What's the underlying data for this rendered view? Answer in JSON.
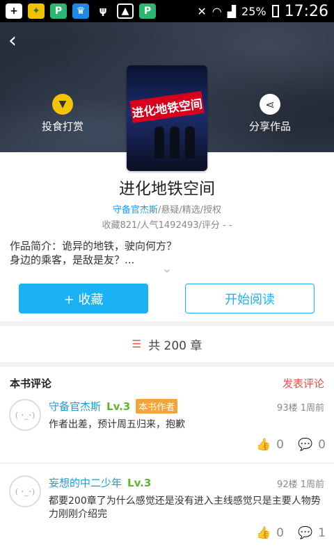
{
  "status_bar": {
    "battery": "25%",
    "time": "17:26"
  },
  "hero": {
    "tip_label": "投食打赏",
    "share_label": "分享作品",
    "cover_text": "进化地铁空间"
  },
  "book": {
    "title": "进化地铁空间",
    "author": "守备官杰斯",
    "tags": "/悬疑/精选/授权",
    "stats": "收藏821/人气1492493/评分 - -",
    "intro": "作品简介：诡异的地铁，驶向何方？\n身边的乘客，是敌是友？..."
  },
  "actions": {
    "favorite_label": "+ 收藏",
    "read_label": "开始阅读"
  },
  "chapters": {
    "label": "共 200 章"
  },
  "comments": {
    "title": "本书评论",
    "post_label": "发表评论",
    "items": [
      {
        "user": "守备官杰斯",
        "level": "Lv.3",
        "badge": "本书作者",
        "floor": "93楼  1周前",
        "text": "作者出差，预计周五归来，抱歉",
        "likes": "0",
        "replies": "0"
      },
      {
        "user": "妄想的中二少年",
        "level": "Lv.3",
        "badge": "",
        "floor": "92楼  1周前",
        "text": "都要200章了为什么感觉还是没有进入主线感觉只是主要人物势力刚刚介绍完",
        "likes": "0",
        "replies": "1"
      }
    ]
  },
  "colors": {
    "accent": "#1ab2f3",
    "link": "#2196f3",
    "danger": "#e5514a"
  }
}
